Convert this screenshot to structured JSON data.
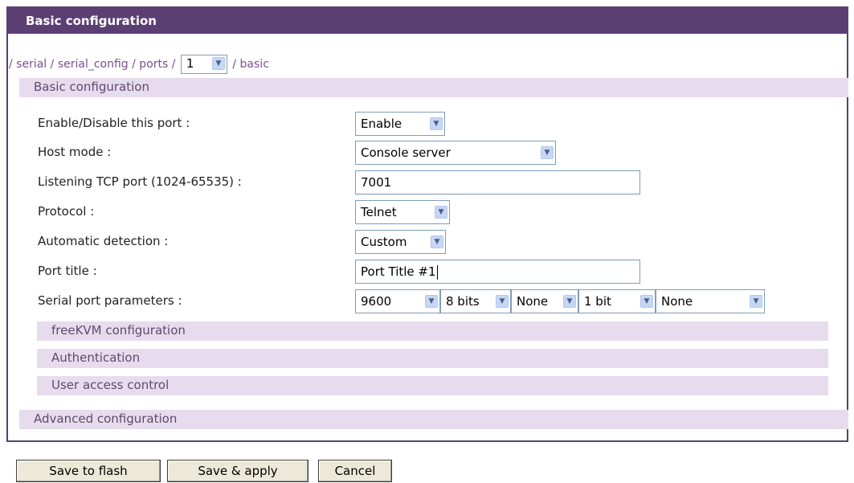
{
  "panel": {
    "title": "Basic configuration"
  },
  "breadcrumb": {
    "parts": [
      "/ serial",
      "/ serial_config",
      "/ ports /"
    ],
    "port_selected": "1",
    "tail": "/ basic"
  },
  "sections": {
    "basic": "Basic configuration",
    "freekvm": "freeKVM configuration",
    "authentication": "Authentication",
    "user_access": "User access control",
    "advanced": "Advanced configuration"
  },
  "form": {
    "enable": {
      "label": "Enable/Disable this port :",
      "value": "Enable"
    },
    "host_mode": {
      "label": "Host mode :",
      "value": "Console server"
    },
    "tcp_port": {
      "label": "Listening TCP port (1024-65535) :",
      "value": "7001"
    },
    "protocol": {
      "label": "Protocol :",
      "value": "Telnet"
    },
    "auto_detect": {
      "label": "Automatic detection :",
      "value": "Custom"
    },
    "port_title": {
      "label": "Port title :",
      "value": "Port Title #1"
    },
    "serial_params": {
      "label": "Serial port parameters :",
      "baud": "9600",
      "data_bits": "8 bits",
      "parity": "None",
      "stop_bits": "1 bit",
      "flow": "None"
    }
  },
  "buttons": {
    "save_flash": "Save to flash",
    "save_apply": "Save & apply",
    "cancel": "Cancel"
  },
  "colors": {
    "header": "#5b3f73",
    "section_bar": "#e7dced",
    "link": "#7a4f93"
  },
  "icons": {
    "dropdown": "chevron-down-icon"
  }
}
